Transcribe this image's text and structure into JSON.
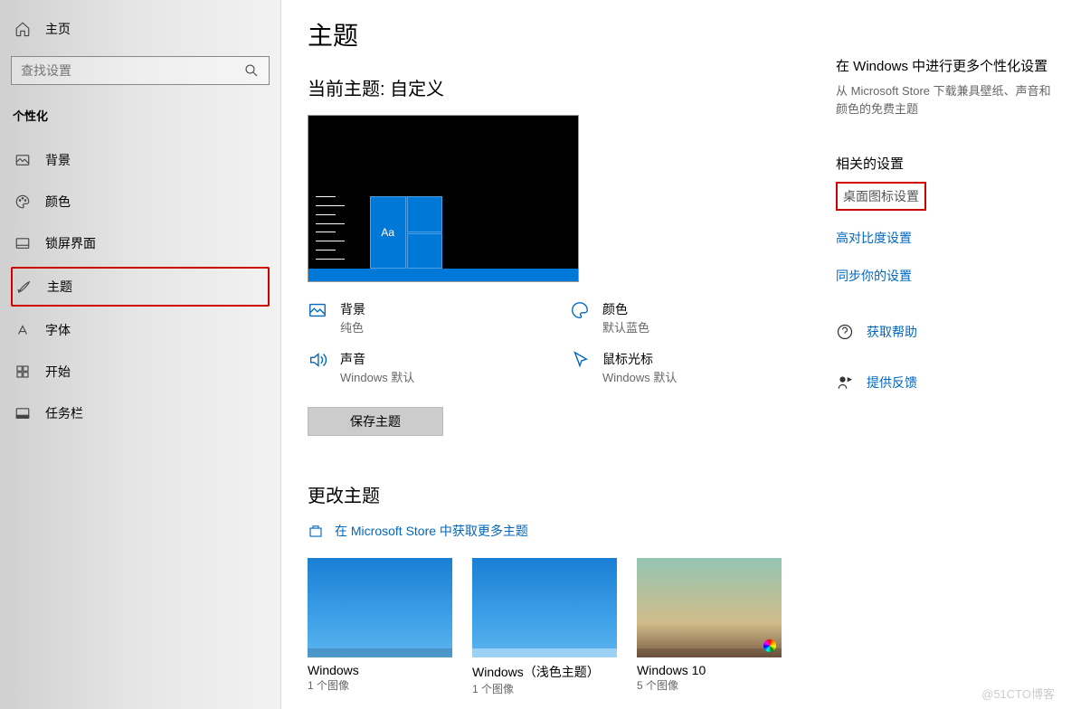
{
  "sidebar": {
    "home": "主页",
    "search_placeholder": "查找设置",
    "section": "个性化",
    "items": [
      {
        "label": "背景"
      },
      {
        "label": "颜色"
      },
      {
        "label": "锁屏界面"
      },
      {
        "label": "主题"
      },
      {
        "label": "字体"
      },
      {
        "label": "开始"
      },
      {
        "label": "任务栏"
      }
    ]
  },
  "main": {
    "title": "主题",
    "current_theme_label": "当前主题: 自定义",
    "preview_tile_text": "Aa",
    "parts": {
      "background": {
        "title": "背景",
        "value": "纯色"
      },
      "color": {
        "title": "颜色",
        "value": "默认蓝色"
      },
      "sound": {
        "title": "声音",
        "value": "Windows 默认"
      },
      "cursor": {
        "title": "鼠标光标",
        "value": "Windows 默认"
      }
    },
    "save_button": "保存主题",
    "change_theme_label": "更改主题",
    "store_link": "在 Microsoft Store 中获取更多主题",
    "themes": [
      {
        "name": "Windows",
        "sub": "1 个图像"
      },
      {
        "name": "Windows（浅色主题）",
        "sub": "1 个图像"
      },
      {
        "name": "Windows 10",
        "sub": "5 个图像"
      }
    ]
  },
  "right": {
    "more_personalize_title": "在 Windows 中进行更多个性化设置",
    "more_personalize_desc": "从 Microsoft Store 下载兼具壁纸、声音和颜色的免费主题",
    "related_title": "相关的设置",
    "links": {
      "desktop_icons": "桌面图标设置",
      "high_contrast": "高对比度设置",
      "sync": "同步你的设置"
    },
    "help": "获取帮助",
    "feedback": "提供反馈"
  },
  "watermark": "@51CTO博客"
}
